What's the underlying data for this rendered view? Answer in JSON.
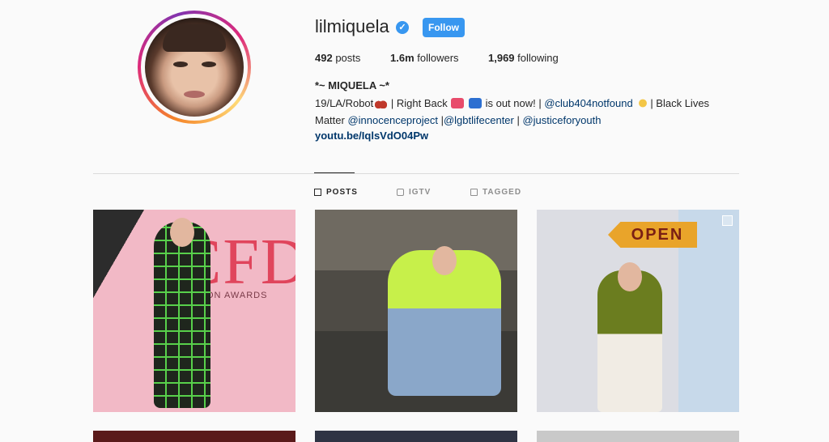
{
  "profile": {
    "username": "lilmiquela",
    "verified": true,
    "follow_label": "Follow",
    "stats": {
      "posts_count": "492",
      "posts_label": "posts",
      "followers_count": "1.6m",
      "followers_label": "followers",
      "following_count": "1,969",
      "following_label": "following"
    },
    "display_name": "*~ MIQUELA ~*",
    "bio": {
      "part1": "19/LA/Robot",
      "part2": " | Right Back ",
      "part3": " is out now! | ",
      "mention1": "@club404notfound",
      "part4": "| Black Lives Matter ",
      "mention2": "@innocenceproject",
      "part5": " |",
      "mention3": "@lgbtlifecenter",
      "part6": " | ",
      "mention4": "@justiceforyouth"
    },
    "link": "youtu.be/IqlsVdO04Pw"
  },
  "tabs": [
    {
      "label": "POSTS",
      "active": true
    },
    {
      "label": "IGTV",
      "active": false
    },
    {
      "label": "TAGGED",
      "active": false
    }
  ],
  "posts": {
    "post1_text": "CFD",
    "post1_subtext": "ON  AWARDS",
    "post3_sign": "OPEN"
  },
  "colors": {
    "accent": "#3897f0",
    "link": "#00376b",
    "background": "#fafafa"
  }
}
